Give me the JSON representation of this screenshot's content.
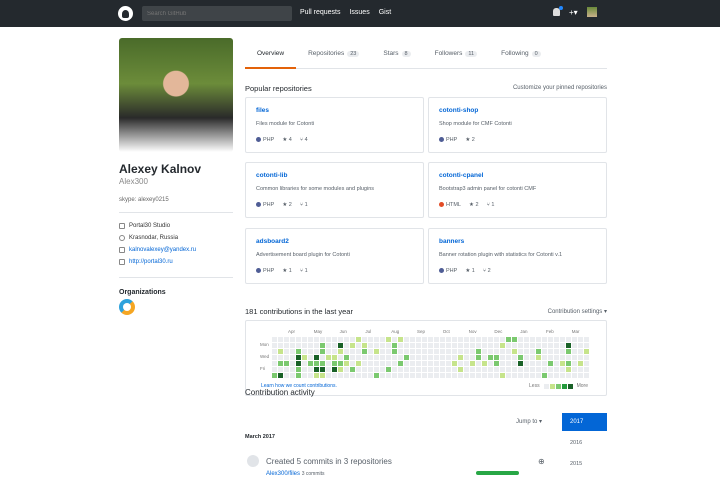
{
  "nav": {
    "search_placeholder": "Search GitHub",
    "links": [
      "Pull requests",
      "Issues",
      "Gist"
    ],
    "plus": "+▾"
  },
  "profile": {
    "name": "Alexey Kalnov",
    "login": "Alex300",
    "bio": "skype: alexey0215",
    "company": "Portal30 Studio",
    "location": "Krasnodar, Russia",
    "email": "kalnovalexey@yandex.ru",
    "url": "http://portal30.ru",
    "orgs_title": "Organizations"
  },
  "tabs": [
    {
      "label": "Overview"
    },
    {
      "label": "Repositories",
      "count": "23"
    },
    {
      "label": "Stars",
      "count": "8"
    },
    {
      "label": "Followers",
      "count": "11"
    },
    {
      "label": "Following",
      "count": "0"
    }
  ],
  "popular": {
    "title": "Popular repositories",
    "customize": "Customize your pinned repositories",
    "repos": [
      {
        "name": "files",
        "desc": "Files module for Cotonti",
        "lang": "PHP",
        "color": "#4F5D95",
        "stars": "4",
        "forks": "4"
      },
      {
        "name": "cotonti-shop",
        "desc": "Shop module for CMF Cotonti",
        "lang": "PHP",
        "color": "#4F5D95",
        "stars": "2",
        "forks": ""
      },
      {
        "name": "cotonti-lib",
        "desc": "Common libraries for some modules and plugins",
        "lang": "PHP",
        "color": "#4F5D95",
        "stars": "2",
        "forks": "1"
      },
      {
        "name": "cotonti-cpanel",
        "desc": "Bootstrap3 admin panel for cotonti CMF",
        "lang": "HTML",
        "color": "#e34c26",
        "stars": "2",
        "forks": "1"
      },
      {
        "name": "adsboard2",
        "desc": "Advertisement board plugin for Cotonti",
        "lang": "PHP",
        "color": "#4F5D95",
        "stars": "1",
        "forks": "1"
      },
      {
        "name": "banners",
        "desc": "Banner rotation plugin with statistics for Cotonti v.1",
        "lang": "PHP",
        "color": "#4F5D95",
        "stars": "1",
        "forks": "2"
      }
    ]
  },
  "contrib": {
    "title": "181 contributions in the last year",
    "settings": "Contribution settings ▾",
    "months": [
      "Apr",
      "May",
      "Jun",
      "Jul",
      "Aug",
      "Sep",
      "Oct",
      "Nov",
      "Dec",
      "Jan",
      "Feb",
      "Mar"
    ],
    "days": [
      "Mon",
      "Wed",
      "Fri"
    ],
    "learn": "Learn how we count contributions.",
    "less": "Less",
    "more": "More",
    "colors": [
      "#ebedf0",
      "#c6e48b",
      "#7bc96f",
      "#239a3b",
      "#196127"
    ],
    "rows": [
      [
        [
          14,
          1
        ],
        [
          19,
          1
        ],
        [
          21,
          1
        ],
        [
          39,
          2
        ],
        [
          40,
          2
        ]
      ],
      [
        [
          8,
          2
        ],
        [
          11,
          4
        ],
        [
          13,
          1
        ],
        [
          15,
          1
        ],
        [
          20,
          2
        ],
        [
          38,
          1
        ],
        [
          49,
          4
        ]
      ],
      [
        [
          1,
          1
        ],
        [
          4,
          2
        ],
        [
          8,
          2
        ],
        [
          11,
          1
        ],
        [
          15,
          2
        ],
        [
          17,
          1
        ],
        [
          20,
          2
        ],
        [
          34,
          2
        ],
        [
          40,
          1
        ],
        [
          44,
          2
        ],
        [
          49,
          2
        ],
        [
          52,
          1
        ]
      ],
      [
        [
          4,
          4
        ],
        [
          5,
          1
        ],
        [
          7,
          4
        ],
        [
          9,
          1
        ],
        [
          10,
          1
        ],
        [
          12,
          2
        ],
        [
          22,
          2
        ],
        [
          31,
          1
        ],
        [
          34,
          2
        ],
        [
          36,
          2
        ],
        [
          37,
          2
        ],
        [
          41,
          2
        ],
        [
          44,
          1
        ]
      ],
      [
        [
          1,
          2
        ],
        [
          2,
          2
        ],
        [
          4,
          4
        ],
        [
          6,
          2
        ],
        [
          7,
          2
        ],
        [
          8,
          2
        ],
        [
          10,
          2
        ],
        [
          11,
          2
        ],
        [
          12,
          1
        ],
        [
          14,
          1
        ],
        [
          21,
          2
        ],
        [
          30,
          1
        ],
        [
          33,
          1
        ],
        [
          35,
          1
        ],
        [
          37,
          2
        ],
        [
          41,
          4
        ],
        [
          46,
          2
        ],
        [
          48,
          1
        ],
        [
          49,
          2
        ],
        [
          51,
          1
        ]
      ],
      [
        [
          4,
          2
        ],
        [
          7,
          4
        ],
        [
          8,
          4
        ],
        [
          10,
          4
        ],
        [
          11,
          1
        ],
        [
          13,
          2
        ],
        [
          19,
          2
        ],
        [
          31,
          1
        ],
        [
          49,
          1
        ]
      ],
      [
        [
          0,
          2
        ],
        [
          1,
          4
        ],
        [
          4,
          2
        ],
        [
          7,
          1
        ],
        [
          8,
          1
        ],
        [
          17,
          2
        ],
        [
          38,
          1
        ],
        [
          45,
          2
        ]
      ]
    ]
  },
  "activity": {
    "title": "Contribution activity",
    "jump": "Jump to ▾",
    "month": "March 2017",
    "years": [
      "2017",
      "2016",
      "2015"
    ],
    "event": "Created 5 commits in 3 repositories",
    "repo": "Alex300/files",
    "repo_commits": "3 commits"
  }
}
